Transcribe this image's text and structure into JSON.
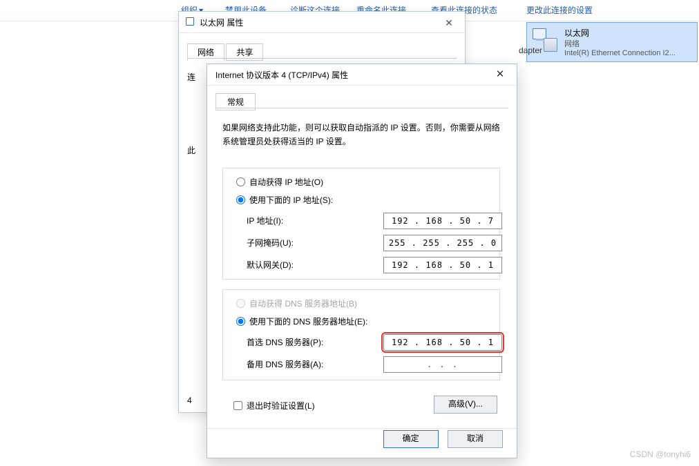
{
  "cmdbar": {
    "organize": "组织",
    "items": [
      "禁用此设备",
      "诊断这个连接",
      "重命名此连接",
      "查看此连接的状态",
      "更改此连接的设置"
    ]
  },
  "adapter": {
    "name": "以太网",
    "type": "网络",
    "device": "Intel(R) Ethernet Connection I2..."
  },
  "win1": {
    "title": "以太网 属性",
    "tabs": [
      "网络",
      "共享"
    ],
    "conn_label": "连",
    "this_label": "此",
    "num4": "4",
    "behind_text": "dapter"
  },
  "win2": {
    "title": "Internet 协议版本 4 (TCP/IPv4) 属性",
    "tab": "常规",
    "info": "如果网络支持此功能，则可以获取自动指派的 IP 设置。否则，你需要从网络系统管理员处获得适当的 IP 设置。",
    "radio_auto_ip": "自动获得 IP 地址(O)",
    "radio_manual_ip": "使用下面的 IP 地址(S):",
    "ip_label": "IP 地址(I):",
    "ip_value": "192 . 168 .  50  .   7",
    "mask_label": "子网掩码(U):",
    "mask_value": "255 . 255 . 255 .   0",
    "gw_label": "默认网关(D):",
    "gw_value": "192 . 168 .  50  .   1",
    "radio_auto_dns": "自动获得 DNS 服务器地址(B)",
    "radio_manual_dns": "使用下面的 DNS 服务器地址(E):",
    "dns1_label": "首选 DNS 服务器(P):",
    "dns1_value": "192 . 168 .  50  .   1",
    "dns2_label": "备用 DNS 服务器(A):",
    "dns2_value": ".       .       .",
    "validate_label": "退出时验证设置(L)",
    "advanced": "高级(V)...",
    "ok": "确定",
    "cancel": "取消"
  },
  "watermark": "CSDN @tonyhi6"
}
